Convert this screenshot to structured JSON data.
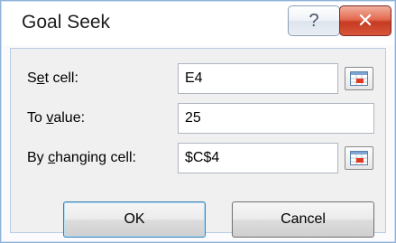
{
  "window": {
    "title": "Goal Seek"
  },
  "titlebar": {
    "help_label": "?",
    "close_label": "✕"
  },
  "fields": [
    {
      "label_pre": "S",
      "label_accel": "e",
      "label_post": "t cell:",
      "value": "E4"
    },
    {
      "label_pre": "To ",
      "label_accel": "v",
      "label_post": "alue:",
      "value": "25"
    },
    {
      "label_pre": "By ",
      "label_accel": "c",
      "label_post": "hanging cell:",
      "value": "$C$4"
    }
  ],
  "buttons": {
    "ok_label": "OK",
    "cancel_label": "Cancel"
  },
  "icons": {
    "help": "question-mark-icon",
    "close": "close-x-icon",
    "range_ref": "range-selector-icon"
  },
  "colors": {
    "close_button": "#c63a21",
    "window_border": "#8fb1d8",
    "dialog_bg": "#f0f0f0"
  }
}
